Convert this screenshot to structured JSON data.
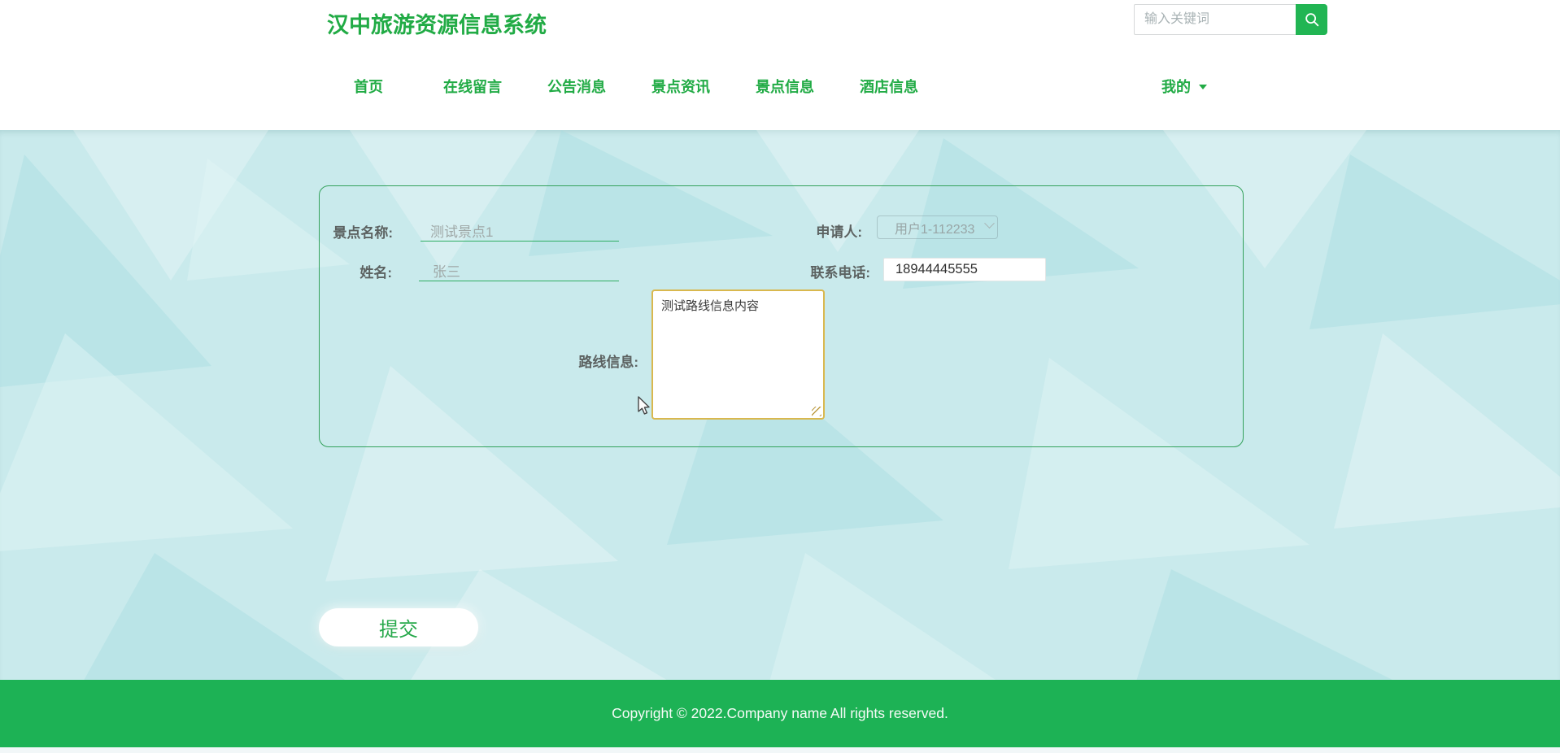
{
  "header": {
    "title": "汉中旅游资源信息系统",
    "search": {
      "placeholder": "输入关键词"
    },
    "nav": [
      {
        "label": "首页"
      },
      {
        "label": "在线留言"
      },
      {
        "label": "公告消息"
      },
      {
        "label": "景点资讯"
      },
      {
        "label": "景点信息"
      },
      {
        "label": "酒店信息"
      }
    ],
    "user_menu": {
      "label": "我的"
    }
  },
  "form": {
    "attraction_name": {
      "label": "景点名称:",
      "value": "测试景点1"
    },
    "applicant": {
      "label": "申请人:",
      "value": "用户1-112233"
    },
    "name": {
      "label": "姓名:",
      "value": "张三"
    },
    "phone": {
      "label": "联系电话:",
      "value": "18944445555"
    },
    "route_info": {
      "label": "路线信息:",
      "value": "测试路线信息内容"
    },
    "submit_label": "提交"
  },
  "footer": {
    "copyright": "Copyright © 2022.Company name All rights reserved."
  },
  "colors": {
    "brand_green": "#21ab45",
    "search_button_green": "#21b553",
    "footer_green": "#1db255",
    "background_aqua": "#c9eaec",
    "panel_border_green": "#34a25c",
    "input_underline_green": "#2fae63",
    "textarea_border_gold": "#d9b84e",
    "muted_value_gray": "#9fa8a7"
  }
}
